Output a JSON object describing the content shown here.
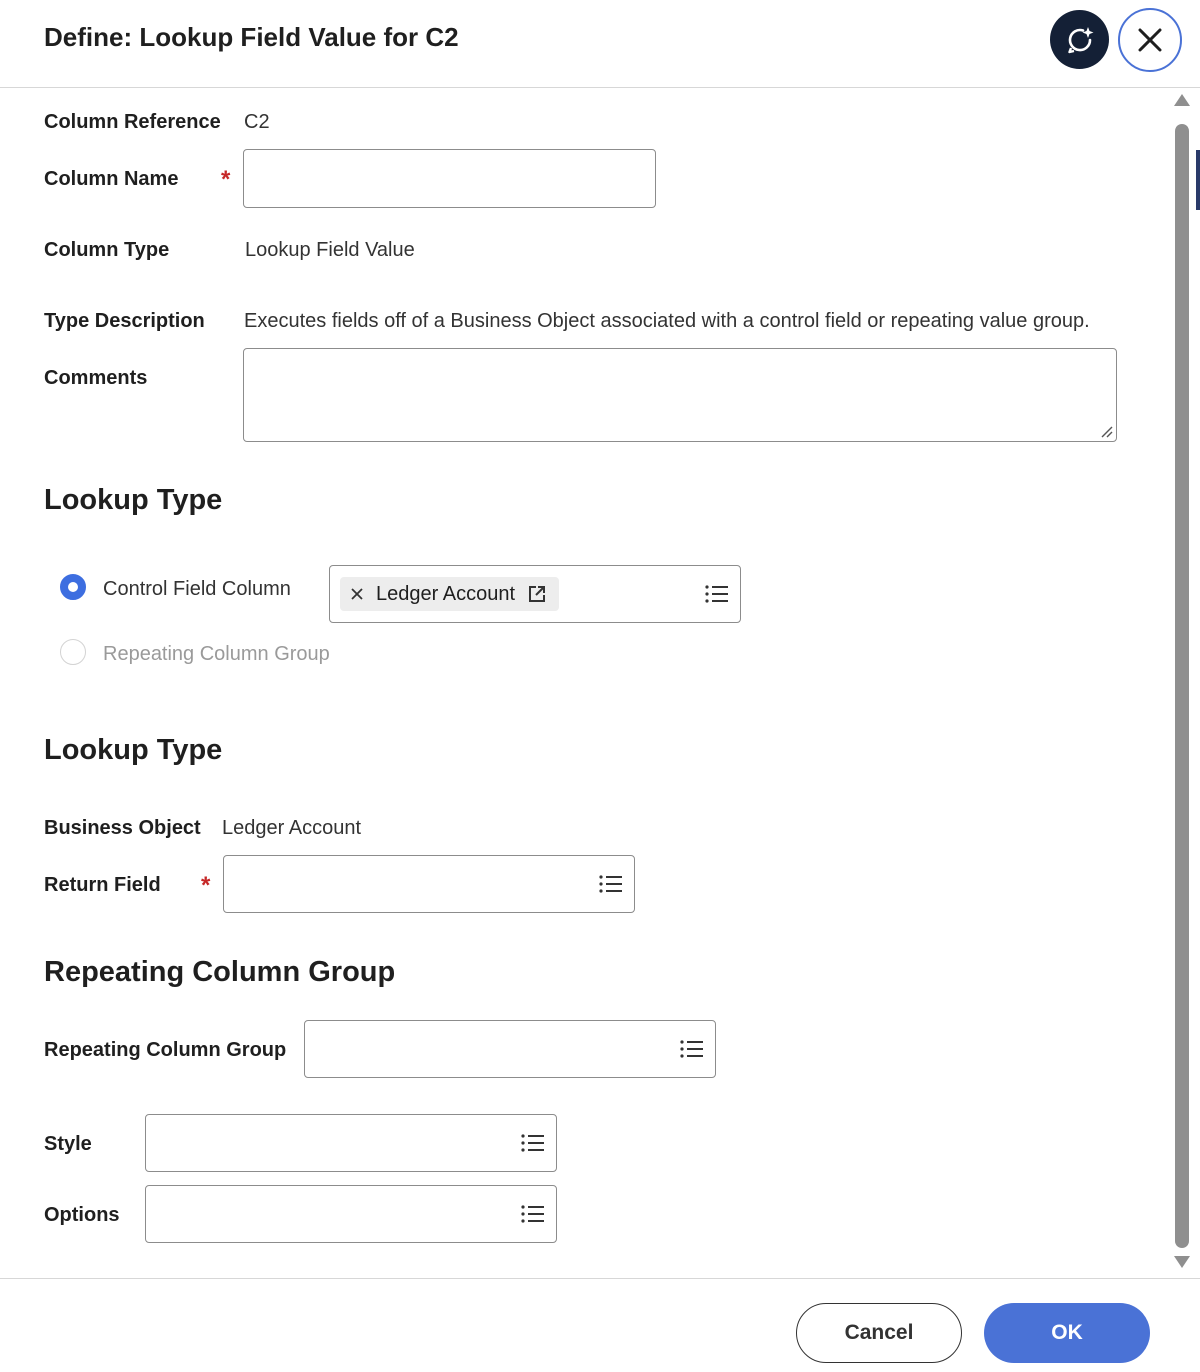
{
  "dialog": {
    "title": "Define: Lookup Field Value for C2",
    "ai_icon": "sparkle-refresh-icon",
    "close_icon": "close-icon"
  },
  "fields": {
    "column_reference": {
      "label": "Column Reference",
      "value": "C2"
    },
    "column_name": {
      "label": "Column Name",
      "required_mark": "*",
      "value": ""
    },
    "column_type": {
      "label": "Column Type",
      "value": "Lookup Field Value"
    },
    "type_description": {
      "label": "Type Description",
      "value": "Executes fields off of a Business Object associated with a control field or repeating value group."
    },
    "comments": {
      "label": "Comments",
      "value": ""
    }
  },
  "lookup_type_1": {
    "title": "Lookup Type",
    "options": [
      {
        "label": "Control Field Column",
        "selected": true
      },
      {
        "label": "Repeating Column Group",
        "selected": false
      }
    ],
    "control_field_value": "Ledger Account"
  },
  "lookup_type_2": {
    "title": "Lookup Type",
    "business_object": {
      "label": "Business Object",
      "value": "Ledger Account"
    },
    "return_field": {
      "label": "Return Field",
      "required_mark": "*",
      "value": ""
    }
  },
  "repeating_column_group": {
    "title": "Repeating Column Group",
    "group_field": {
      "label": "Repeating Column Group",
      "value": ""
    },
    "style": {
      "label": "Style",
      "value": ""
    },
    "options": {
      "label": "Options",
      "value": ""
    }
  },
  "footer": {
    "cancel_label": "Cancel",
    "ok_label": "OK"
  },
  "colors": {
    "accent": "#4a72d6",
    "ai_button": "#142036",
    "required": "#c62828"
  }
}
